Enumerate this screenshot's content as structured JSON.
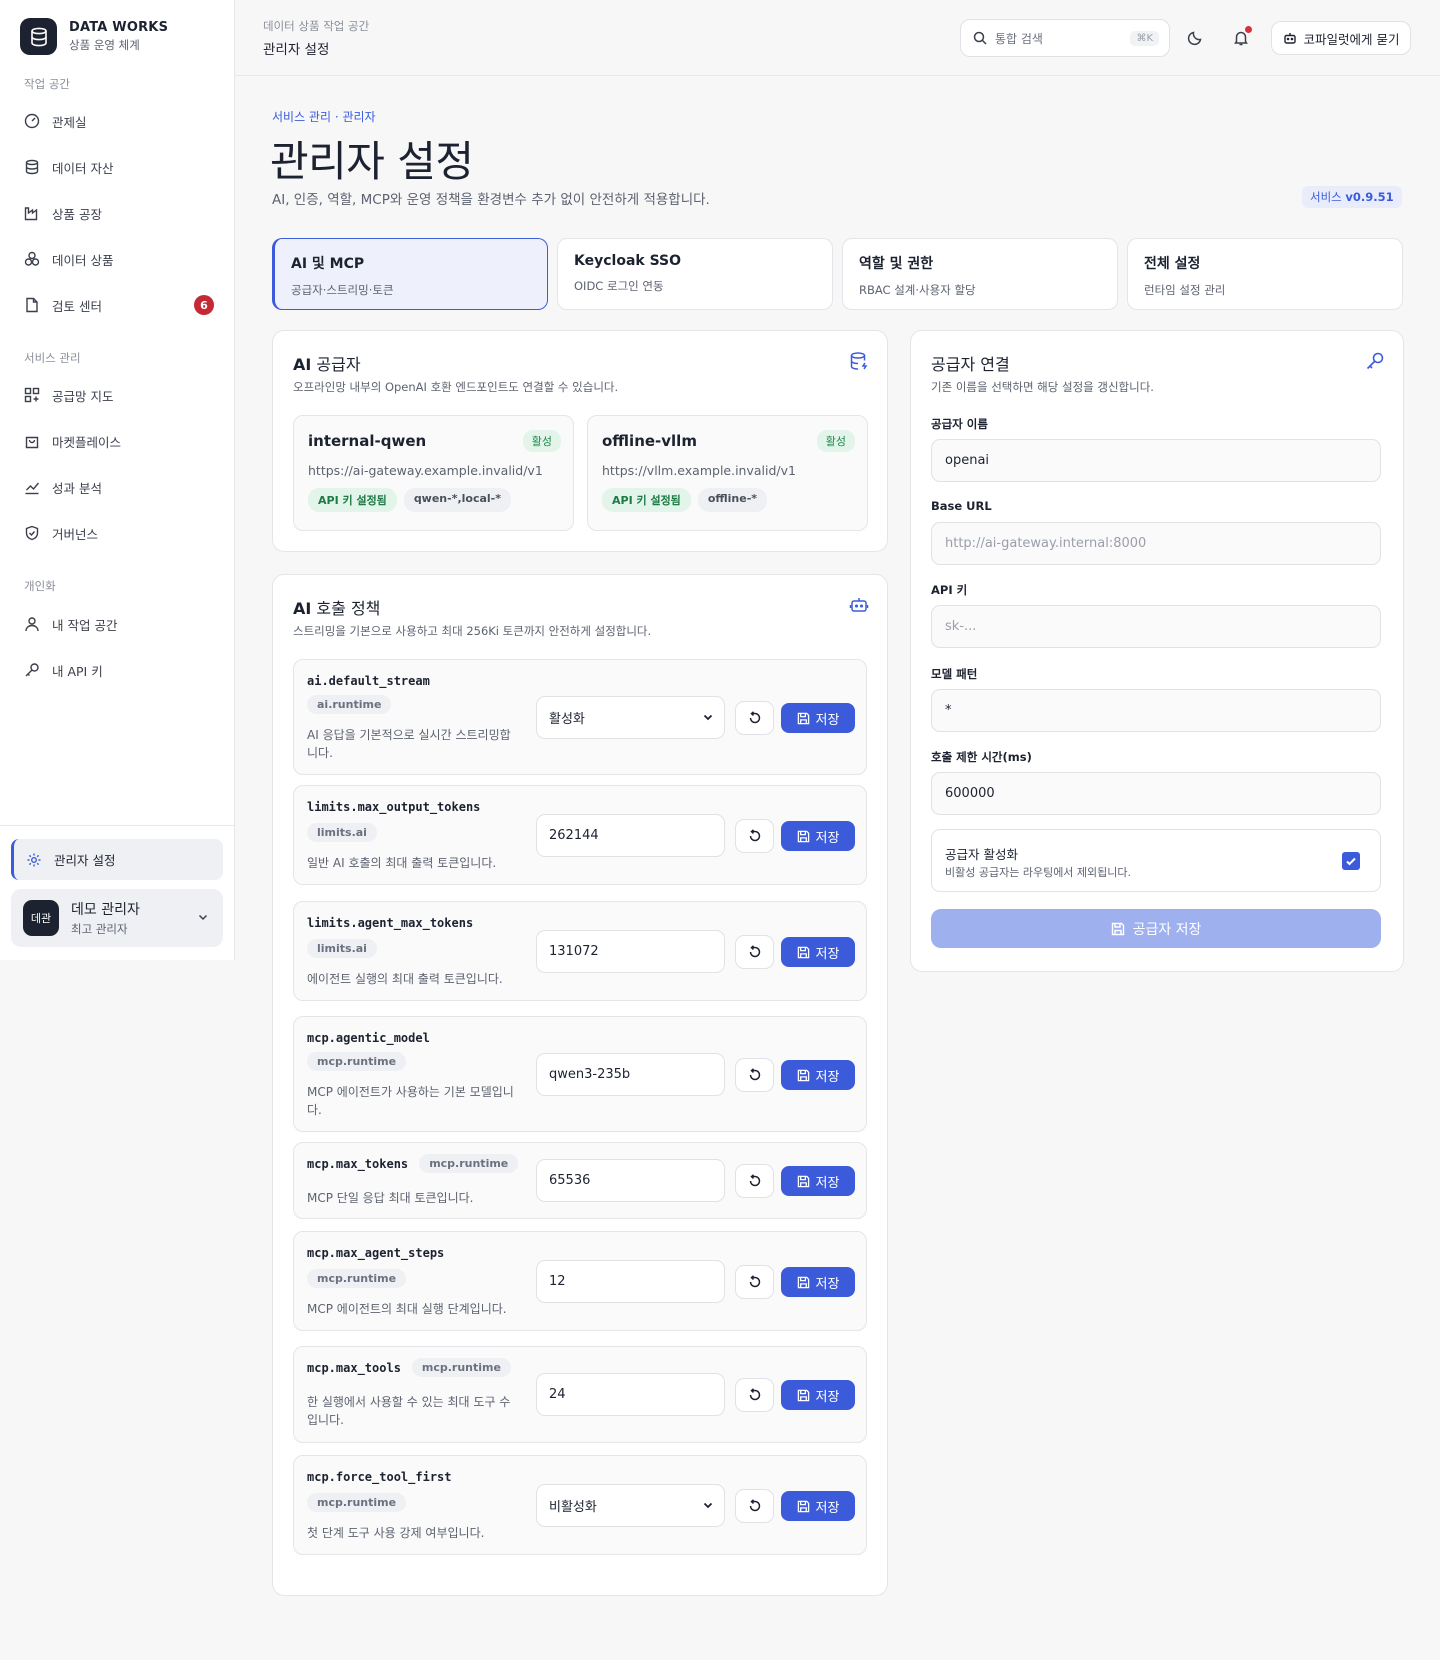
{
  "brand": {
    "title": "DATA WORKS",
    "subtitle": "상품 운영 체계"
  },
  "sidebar": {
    "sections": [
      {
        "label": "작업 공간",
        "items": [
          {
            "label": "관제실",
            "icon": "gauge-icon"
          },
          {
            "label": "데이터 자산",
            "icon": "database-icon"
          },
          {
            "label": "상품 공장",
            "icon": "factory-icon"
          },
          {
            "label": "데이터 상품",
            "icon": "cubes-icon"
          },
          {
            "label": "검토 센터",
            "icon": "document-icon",
            "badge": "6"
          }
        ]
      },
      {
        "label": "서비스 관리",
        "items": [
          {
            "label": "공급망 지도",
            "icon": "network-icon"
          },
          {
            "label": "마켓플레이스",
            "icon": "shopping-bag-icon"
          },
          {
            "label": "성과 분석",
            "icon": "chart-icon"
          },
          {
            "label": "거버넌스",
            "icon": "shield-icon"
          }
        ]
      },
      {
        "label": "개인화",
        "items": [
          {
            "label": "내 작업 공간",
            "icon": "user-icon"
          },
          {
            "label": "내 API 키",
            "icon": "key-icon"
          }
        ]
      }
    ],
    "active_item": "관리자 설정",
    "user": {
      "avatar": "데관",
      "name": "데모 관리자",
      "role": "최고 관리자"
    }
  },
  "topbar": {
    "crumb_small": "데이터 상품 작업 공간",
    "crumb_main": "관리자 설정",
    "search_placeholder": "통합 검색",
    "search_shortcut": "⌘K",
    "copilot_label": "코파일럿에게 묻기"
  },
  "page": {
    "breadcrumb": "서비스 관리 · 관리자",
    "title": "관리자 설정",
    "description": "AI, 인증, 역할, MCP와 운영 정책을 환경변수 추가 없이 안전하게 적용합니다.",
    "version_prefix": "서비스",
    "version": "v0.9.51"
  },
  "tabs": [
    {
      "title": "AI 및 MCP",
      "subtitle": "공급자·스트리밍·토큰",
      "active": true
    },
    {
      "title": "Keycloak SSO",
      "subtitle": "OIDC 로그인 연동",
      "active": false
    },
    {
      "title": "역할 및 권한",
      "subtitle": "RBAC 설계·사용자 할당",
      "active": false
    },
    {
      "title": "전체 설정",
      "subtitle": "런타임 설정 관리",
      "active": false
    }
  ],
  "providers_card": {
    "title_bold": "AI",
    "title_rest": " 공급자",
    "description": "오프라인망 내부의 OpenAI 호환 엔드포인트도 연결할 수 있습니다.",
    "providers": [
      {
        "name": "internal-qwen",
        "status": "활성",
        "url": "https://ai-gateway.example.invalid/v1",
        "key_tag": "API 키 설정됨",
        "pattern": "qwen-*,local-*"
      },
      {
        "name": "offline-vllm",
        "status": "활성",
        "url": "https://vllm.example.invalid/v1",
        "key_tag": "API 키 설정됨",
        "pattern": "offline-*"
      }
    ]
  },
  "policy_card": {
    "title_bold": "AI",
    "title_rest": " 호출 정책",
    "description": "스트리밍을 기본으로 사용하고 최대 256Ki 토큰까지 안전하게 설정합니다.",
    "save_label": "저장",
    "policies": [
      {
        "key": "ai.default_stream",
        "tag": "ai.runtime",
        "desc": "AI 응답을 기본적으로 실시간 스트리밍합니다.",
        "value": "활성화",
        "type": "select"
      },
      {
        "key": "limits.max_output_tokens",
        "tag": "limits.ai",
        "desc": "일반 AI 호출의 최대 출력 토큰입니다.",
        "value": "262144",
        "type": "input"
      },
      {
        "key": "limits.agent_max_tokens",
        "tag": "limits.ai",
        "desc": "에이전트 실행의 최대 출력 토큰입니다.",
        "value": "131072",
        "type": "input"
      },
      {
        "key": "mcp.agentic_model",
        "tag": "mcp.runtime",
        "desc": "MCP 에이전트가 사용하는 기본 모델입니다.",
        "value": "qwen3-235b",
        "type": "input"
      },
      {
        "key": "mcp.max_tokens",
        "tag": "mcp.runtime",
        "desc": "MCP 단일 응답 최대 토큰입니다.",
        "value": "65536",
        "type": "input"
      },
      {
        "key": "mcp.max_agent_steps",
        "tag": "mcp.runtime",
        "desc": "MCP 에이전트의 최대 실행 단계입니다.",
        "value": "12",
        "type": "input"
      },
      {
        "key": "mcp.max_tools",
        "tag": "mcp.runtime",
        "desc": "한 실행에서 사용할 수 있는 최대 도구 수입니다.",
        "value": "24",
        "type": "input"
      },
      {
        "key": "mcp.force_tool_first",
        "tag": "mcp.runtime",
        "desc": "첫 단계 도구 사용 강제 여부입니다.",
        "value": "비활성화",
        "type": "select"
      }
    ]
  },
  "connection_card": {
    "title": "공급자 연결",
    "description": "기존 이름을 선택하면 해당 설정을 갱신합니다.",
    "fields": [
      {
        "label": "공급자 이름",
        "value": "openai",
        "placeholder": ""
      },
      {
        "label": "Base URL",
        "value": "",
        "placeholder": "http://ai-gateway.internal:8000"
      },
      {
        "label": "API 키",
        "value": "",
        "placeholder": "sk-..."
      },
      {
        "label": "모델 패턴",
        "value": "*",
        "placeholder": ""
      },
      {
        "label": "호출 제한 시간(ms)",
        "value": "600000",
        "placeholder": ""
      }
    ],
    "toggle_title": "공급자 활성화",
    "toggle_sub": "비활성 공급자는 라우팅에서 제외됩니다.",
    "toggle_checked": true,
    "save_label": "공급자 저장"
  }
}
